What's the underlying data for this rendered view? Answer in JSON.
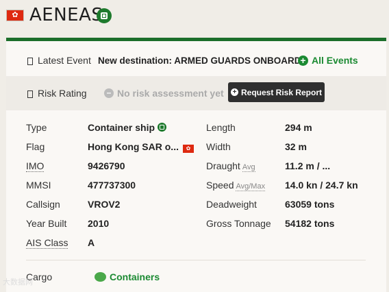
{
  "header": {
    "ship_name": "AENEAS",
    "flag_glyph": "✿"
  },
  "latest_event": {
    "label": "Latest Event",
    "value": "New destination: ARMED GUARDS ONBOARD",
    "link": "All Events"
  },
  "risk": {
    "label": "Risk Rating",
    "status": "No risk assessment yet",
    "button": "Request Risk Report"
  },
  "details_left": [
    {
      "label": "Type",
      "value": "Container ship"
    },
    {
      "label": "Flag",
      "value": "Hong Kong SAR o..."
    },
    {
      "label": "IMO",
      "value": "9426790"
    },
    {
      "label": "MMSI",
      "value": "477737300"
    },
    {
      "label": "Callsign",
      "value": "VROV2"
    },
    {
      "label": "Year Built",
      "value": "2010"
    },
    {
      "label": "AIS Class",
      "value": "A"
    }
  ],
  "details_right": [
    {
      "label": "Length",
      "sub": "",
      "value": "294 m"
    },
    {
      "label": "Width",
      "sub": "",
      "value": "32 m"
    },
    {
      "label": "Draught",
      "sub": "Avg",
      "value": "11.2 m / ..."
    },
    {
      "label": "Speed",
      "sub": "Avg/Max",
      "value": "14.0 kn / 24.7 kn"
    },
    {
      "label": "Deadweight",
      "sub": "",
      "value": "63059 tons"
    },
    {
      "label": "Gross Tonnage",
      "sub": "",
      "value": "54182 tons"
    }
  ],
  "cargo": {
    "label": "Cargo",
    "value": "Containers"
  },
  "watermark": "大数据网",
  "colors": {
    "accent_green": "#1b8a32",
    "brand_dark_green": "#1b6e2a",
    "button_dark": "#2f2f2f"
  }
}
